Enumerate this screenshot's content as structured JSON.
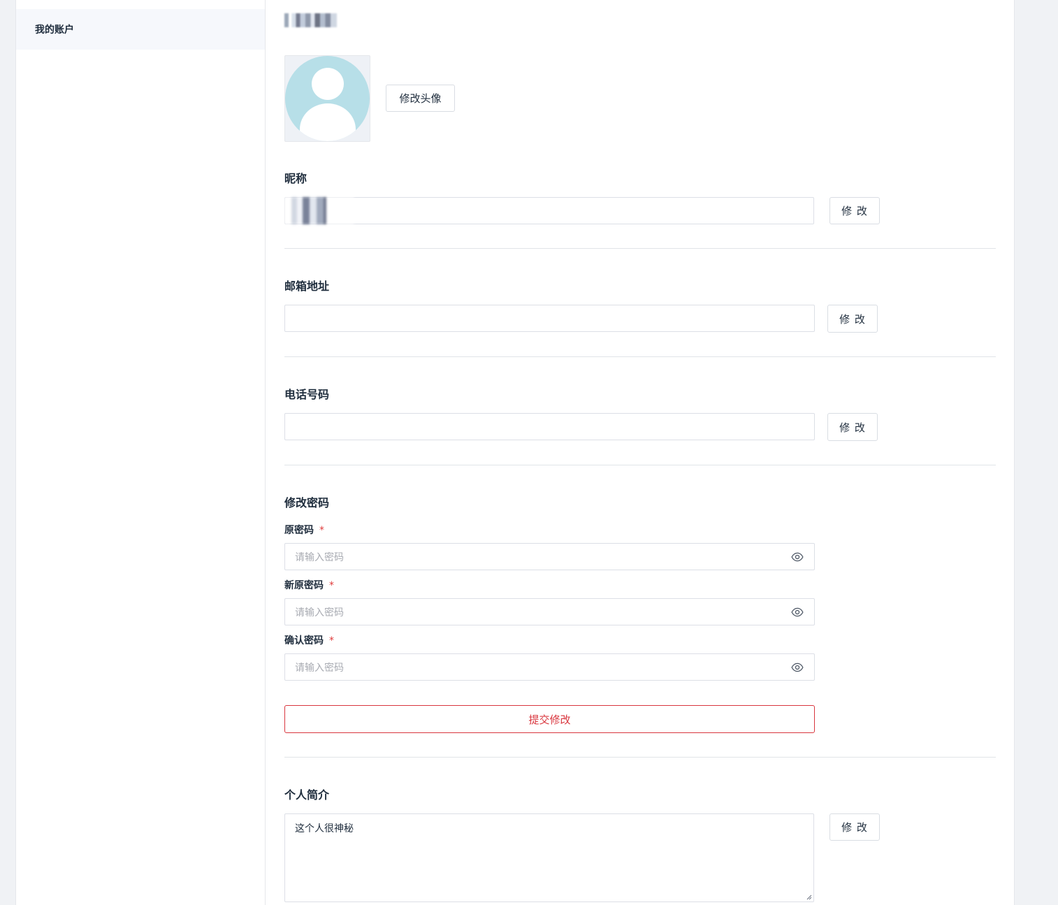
{
  "sidebar": {
    "items": [
      {
        "label": "我的账户"
      }
    ]
  },
  "profile": {
    "username": "",
    "change_avatar_label": "修改头像"
  },
  "nickname": {
    "title": "昵称",
    "value": "",
    "button": "修 改"
  },
  "email": {
    "title": "邮箱地址",
    "value": "",
    "button": "修 改"
  },
  "phone": {
    "title": "电话号码",
    "value": "",
    "button": "修 改"
  },
  "password": {
    "title": "修改密码",
    "old_label": "原密码",
    "new_label": "新原密码",
    "confirm_label": "确认密码",
    "required_mark": "*",
    "placeholder": "请输入密码",
    "submit_label": "提交修改"
  },
  "bio": {
    "title": "个人简介",
    "value": "这个人很神秘",
    "button": "修 改"
  },
  "colors": {
    "accent": "#d9363e",
    "avatar_bg": "#b7dfe8",
    "sidebar_active_bg": "#f6f8fc"
  },
  "icons": {
    "password_toggle": "eye-icon",
    "avatar": "user-placeholder-icon"
  }
}
